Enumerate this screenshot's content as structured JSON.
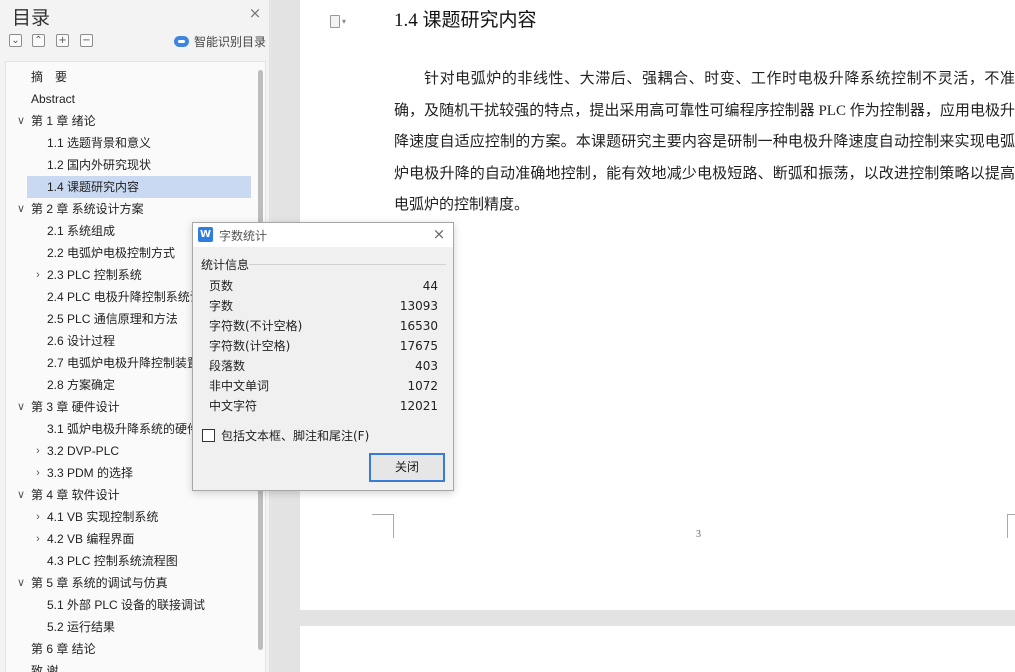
{
  "nav": {
    "title": "目录",
    "close_glyph": "×",
    "toolbar": [
      {
        "name": "collapse-all-button",
        "glyph": "⌄"
      },
      {
        "name": "expand-up-button",
        "glyph": "⌃"
      },
      {
        "name": "add-heading-button",
        "glyph": "+"
      },
      {
        "name": "remove-heading-button",
        "glyph": "−"
      }
    ],
    "smart_label": "智能识别目录",
    "toc": [
      {
        "label": "摘　要",
        "level": 0,
        "arrow": ""
      },
      {
        "label": "Abstract",
        "level": 0,
        "arrow": ""
      },
      {
        "label": "第 1 章  绪论",
        "level": 0,
        "arrow": "v"
      },
      {
        "label": "1.1 选题背景和意义",
        "level": 1,
        "arrow": ""
      },
      {
        "label": "1.2 国内外研究现状",
        "level": 1,
        "arrow": ""
      },
      {
        "label": "1.4 课题研究内容",
        "level": 1,
        "arrow": "",
        "selected": true
      },
      {
        "label": "第 2 章  系统设计方案",
        "level": 0,
        "arrow": "v"
      },
      {
        "label": "2.1 系统组成",
        "level": 1,
        "arrow": ""
      },
      {
        "label": "2.2 电弧炉电极控制方式",
        "level": 1,
        "arrow": ""
      },
      {
        "label": "2.3 PLC 控制系统",
        "level": 1,
        "arrow": ">"
      },
      {
        "label": "2.4 PLC 电极升降控制系统设计",
        "level": 1,
        "arrow": ""
      },
      {
        "label": "2.5 PLC 通信原理和方法",
        "level": 1,
        "arrow": ""
      },
      {
        "label": "2.6  设计过程",
        "level": 1,
        "arrow": ""
      },
      {
        "label": "2.7 电弧炉电极升降控制装置",
        "level": 1,
        "arrow": ""
      },
      {
        "label": "2.8  方案确定",
        "level": 1,
        "arrow": ""
      },
      {
        "label": "第 3 章  硬件设计",
        "level": 0,
        "arrow": "v"
      },
      {
        "label": "3.1  弧炉电极升降系统的硬件",
        "level": 1,
        "arrow": ""
      },
      {
        "label": "3.2 DVP-PLC",
        "level": 1,
        "arrow": ">"
      },
      {
        "label": "3.3     PDM 的选择",
        "level": 1,
        "arrow": ">"
      },
      {
        "label": "第 4 章  软件设计",
        "level": 0,
        "arrow": "v"
      },
      {
        "label": "4.1 VB 实现控制系统",
        "level": 1,
        "arrow": ">"
      },
      {
        "label": "4.2 VB 编程界面",
        "level": 1,
        "arrow": ">"
      },
      {
        "label": "4.3 PLC 控制系统流程图",
        "level": 1,
        "arrow": ""
      },
      {
        "label": "第 5 章  系统的调试与仿真",
        "level": 0,
        "arrow": "v"
      },
      {
        "label": "5.1 外部 PLC 设备的联接调试",
        "level": 1,
        "arrow": ""
      },
      {
        "label": "5.2 运行结果",
        "level": 1,
        "arrow": ""
      },
      {
        "label": "第 6 章  结论",
        "level": 0,
        "arrow": ""
      },
      {
        "label": "致  谢",
        "level": 0,
        "arrow": ""
      }
    ]
  },
  "document": {
    "heading": "1.4 课题研究内容",
    "paragraph": "针对电弧炉的非线性、大滞后、强耦合、时变、工作时电极升降系统控制不灵活，不准确，及随机干扰较强的特点，提出采用高可靠性可编程序控制器 PLC 作为控制器，应用电极升降速度自适应控制的方案。本课题研究主要内容是研制一种电极升降速度自动控制来实现电弧炉电极升降的自动准确地控制，能有效地减少电极短路、断弧和振荡，以改进控制策略以提高电弧炉的控制精度。",
    "page_number": "3"
  },
  "dialog": {
    "title": "字数统计",
    "logo_glyph": "W",
    "close_glyph": "×",
    "section_label": "统计信息",
    "stats": [
      {
        "label": "页数",
        "value": "44"
      },
      {
        "label": "字数",
        "value": "13093"
      },
      {
        "label": "字符数(不计空格)",
        "value": "16530"
      },
      {
        "label": "字符数(计空格)",
        "value": "17675"
      },
      {
        "label": "段落数",
        "value": "403"
      },
      {
        "label": "非中文单词",
        "value": "1072"
      },
      {
        "label": "中文字符",
        "value": "12021"
      }
    ],
    "checkbox_label": "包括文本框、脚注和尾注(F)",
    "checkbox_checked": false,
    "close_button": "关闭"
  },
  "colors": {
    "accent": "#3a7bd5",
    "selection": "#c9d9f1",
    "smart_icon": "#3a86e0"
  }
}
